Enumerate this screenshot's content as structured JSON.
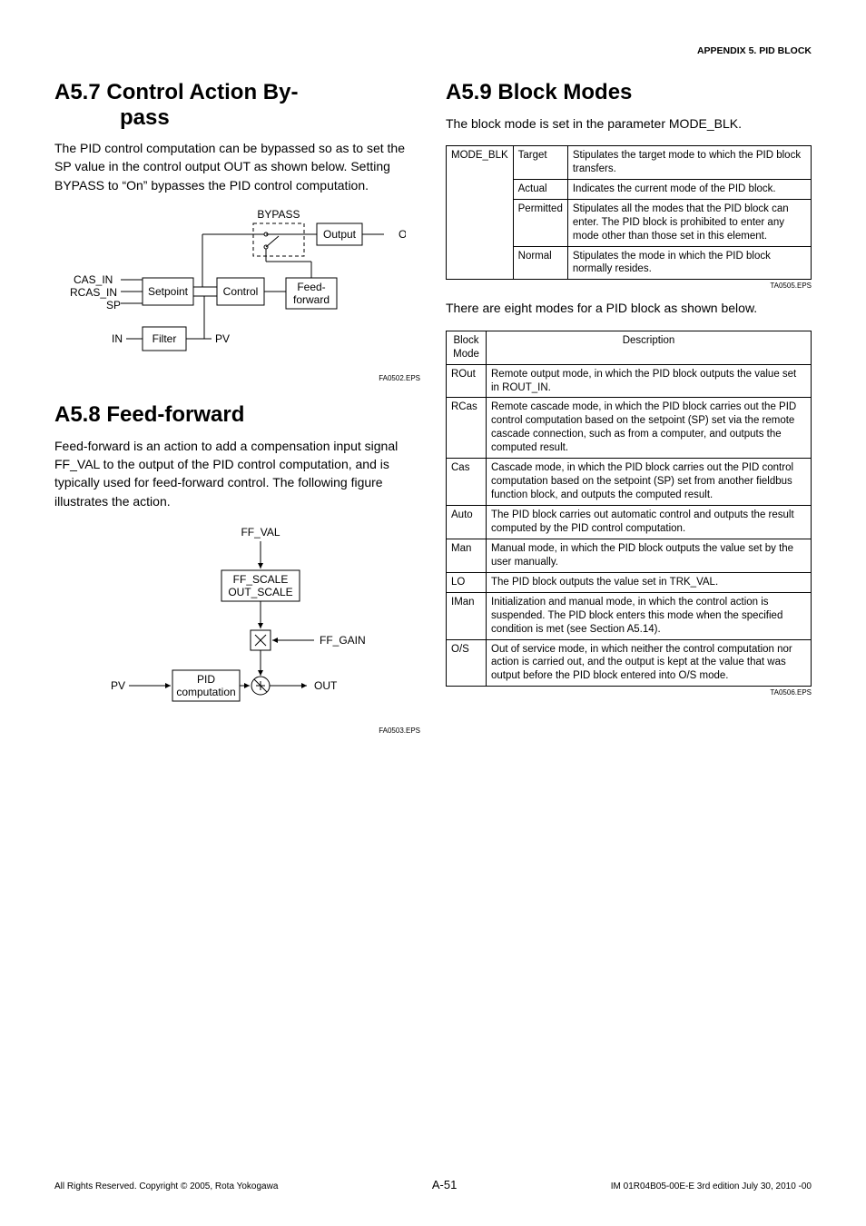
{
  "header": {
    "appendix": "APPENDIX 5.  PID BLOCK"
  },
  "left": {
    "s1": {
      "title_a": "A5.7  Control Action By-",
      "title_b": "pass",
      "body": "The PID control computation can be bypassed so as to set the SP value in the control output OUT as shown below.  Setting BYPASS to “On” bypasses the PID control computation.",
      "fig_tag": "FA0502.EPS",
      "d": {
        "bypass": "BYPASS",
        "output": "Output",
        "out": "OUT",
        "cas_in": "CAS_IN",
        "rcas_in": "RCAS_IN",
        "sp": "SP",
        "in": "IN",
        "setpoint": "Setpoint",
        "control": "Control",
        "feedforward": "Feed-\nforward",
        "filter": "Filter",
        "pv": "PV"
      }
    },
    "s2": {
      "title": "A5.8  Feed-forward",
      "body": "Feed-forward is an action to add a compensa­tion input signal FF_VAL to the output of the PID control computation, and is typically used for feed-forward control.  The following figure illustrates the action.",
      "fig_tag": "FA0503.EPS",
      "d": {
        "ff_val": "FF_VAL",
        "ff_scale": "FF_SCALE",
        "out_scale": "OUT_SCALE",
        "ff_gain": "FF_GAIN",
        "pv": "PV",
        "pid": "PID\ncomputation",
        "out": "OUT"
      }
    }
  },
  "right": {
    "title": "A5.9  Block Modes",
    "intro": "The block mode is set in the parameter MODE_BLK.",
    "t1": {
      "r0c0": "MODE_BLK",
      "rows": [
        {
          "k": "Target",
          "v": "Stipulates the target mode to which the PID block transfers."
        },
        {
          "k": "Actual",
          "v": "Indicates the current mode of the PID block."
        },
        {
          "k": "Permitted",
          "v": "Stipulates all the modes that the PID block can enter.  The PID block is prohibited to enter any mode other than those set in this element."
        },
        {
          "k": "Normal",
          "v": "Stipulates the mode in which the PID block normally resides."
        }
      ],
      "tag": "TA0505.EPS"
    },
    "mid": "There are eight modes for a PID block as shown below.",
    "t2": {
      "h1": "Block\nMode",
      "h2": "Description",
      "rows": [
        {
          "k": "ROut",
          "v": "Remote output mode, in which the PID block outputs the value set in ROUT_IN."
        },
        {
          "k": "RCas",
          "v": "Remote cascade mode, in which the PID block carries out the PID control computation based on the setpoint (SP) set via the remote cascade connection, such as from a computer, and outputs the computed result."
        },
        {
          "k": "Cas",
          "v": "Cascade mode, in which the PID block carries out the PID control computation based on the setpoint (SP) set from another fieldbus function block, and outputs the computed result."
        },
        {
          "k": "Auto",
          "v": "The PID block carries out automatic control and outputs the result computed by the PID control computation."
        },
        {
          "k": "Man",
          "v": "Manual mode, in which the PID block outputs the value set by the user manually."
        },
        {
          "k": "LO",
          "v": "The PID block outputs the value set in TRK_VAL."
        },
        {
          "k": "IMan",
          "v": "Initialization and manual mode, in which the control action is suspended.  The PID block enters this mode when the specified condition is met (see Section A5.14)."
        },
        {
          "k": "O/S",
          "v": "Out of service mode, in which neither the control computation nor action is carried out, and the output is kept at the value that was output before the PID block entered into O/S mode."
        }
      ],
      "tag": "TA0506.EPS"
    }
  },
  "footer": {
    "left": "All Rights Reserved. Copyright © 2005, Rota Yokogawa",
    "center": "A-51",
    "right": "IM 01R04B05-00E-E    3rd edition  July 30, 2010 -00"
  }
}
